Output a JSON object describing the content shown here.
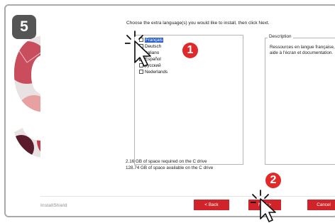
{
  "step_number": "5",
  "dialog": {
    "instruction": "Choose the extra language(s) you would like to install, then click Next.",
    "languages": [
      {
        "label": "Français",
        "checked": false,
        "selected": true
      },
      {
        "label": "Deutsch",
        "checked": false,
        "selected": false
      },
      {
        "label": "Italiano",
        "checked": false,
        "selected": false
      },
      {
        "label": "Español",
        "checked": false,
        "selected": false
      },
      {
        "label": "русский",
        "checked": false,
        "selected": false
      },
      {
        "label": "Nederlands",
        "checked": false,
        "selected": false
      }
    ],
    "description_legend": "Description",
    "description_text": "Ressources en langue française, aide à l'écran et documentation.",
    "space_required": "2.16 GB of space required on the C drive",
    "space_available": "128.74 GB of space available on the C drive",
    "installshield": "InstallShield",
    "buttons": {
      "back": "< Back",
      "next": "Next >",
      "cancel": "Cancel"
    }
  },
  "annotations": {
    "badge1": "1",
    "badge2": "2"
  },
  "colors": {
    "accent": "#d1232a",
    "selection": "#2b61c7",
    "step_badge": "#555555"
  }
}
